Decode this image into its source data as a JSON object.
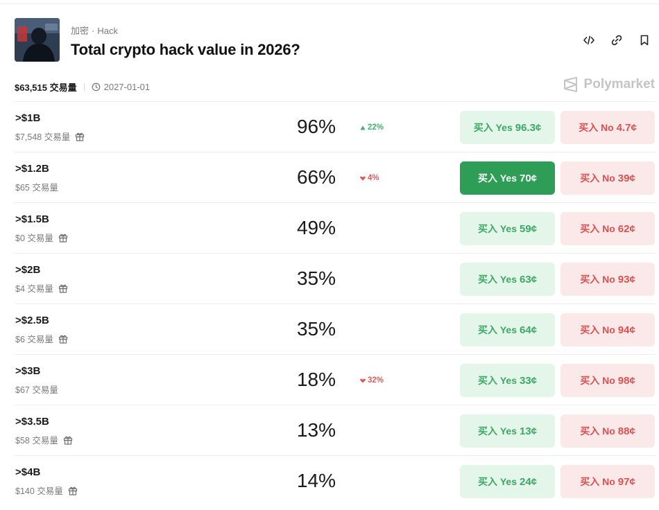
{
  "market": {
    "category": "加密",
    "tag": "Hack",
    "title": "Total crypto hack value in 2026?",
    "volume": "$63,515 交易量",
    "end_date": "2027-01-01",
    "brand": "Polymarket"
  },
  "icons": [
    "code-embed-icon",
    "link-icon",
    "bookmark-icon",
    "clock-icon",
    "gift-icon",
    "polymarket-logo-icon"
  ],
  "colors": {
    "yes": "#3ca865",
    "yes_bg": "#e4f5ea",
    "yes_active": "#2e9e57",
    "no": "#dc5050",
    "no_bg": "#fbe9e9"
  },
  "outcomes": [
    {
      "label": ">$1B",
      "volume": "$7,548 交易量",
      "gift": true,
      "pct": "96%",
      "change": "22%",
      "dir": "up",
      "yes_label": "买入 Yes",
      "yes_price": "96.3¢",
      "no_label": "买入 No",
      "no_price": "4.7¢",
      "active": false
    },
    {
      "label": ">$1.2B",
      "volume": "$65 交易量",
      "gift": false,
      "pct": "66%",
      "change": "4%",
      "dir": "down",
      "yes_label": "买入 Yes",
      "yes_price": "70¢",
      "no_label": "买入 No",
      "no_price": "39¢",
      "active": true
    },
    {
      "label": ">$1.5B",
      "volume": "$0 交易量",
      "gift": true,
      "pct": "49%",
      "change": "",
      "dir": "",
      "yes_label": "买入 Yes",
      "yes_price": "59¢",
      "no_label": "买入 No",
      "no_price": "62¢",
      "active": false
    },
    {
      "label": ">$2B",
      "volume": "$4 交易量",
      "gift": true,
      "pct": "35%",
      "change": "",
      "dir": "",
      "yes_label": "买入 Yes",
      "yes_price": "63¢",
      "no_label": "买入 No",
      "no_price": "93¢",
      "active": false
    },
    {
      "label": ">$2.5B",
      "volume": "$6 交易量",
      "gift": true,
      "pct": "35%",
      "change": "",
      "dir": "",
      "yes_label": "买入 Yes",
      "yes_price": "64¢",
      "no_label": "买入 No",
      "no_price": "94¢",
      "active": false
    },
    {
      "label": ">$3B",
      "volume": "$67 交易量",
      "gift": false,
      "pct": "18%",
      "change": "32%",
      "dir": "down",
      "yes_label": "买入 Yes",
      "yes_price": "33¢",
      "no_label": "买入 No",
      "no_price": "98¢",
      "active": false
    },
    {
      "label": ">$3.5B",
      "volume": "$58 交易量",
      "gift": true,
      "pct": "13%",
      "change": "",
      "dir": "",
      "yes_label": "买入 Yes",
      "yes_price": "13¢",
      "no_label": "买入 No",
      "no_price": "88¢",
      "active": false
    },
    {
      "label": ">$4B",
      "volume": "$140 交易量",
      "gift": true,
      "pct": "14%",
      "change": "",
      "dir": "",
      "yes_label": "买入 Yes",
      "yes_price": "24¢",
      "no_label": "买入 No",
      "no_price": "97¢",
      "active": false
    }
  ]
}
